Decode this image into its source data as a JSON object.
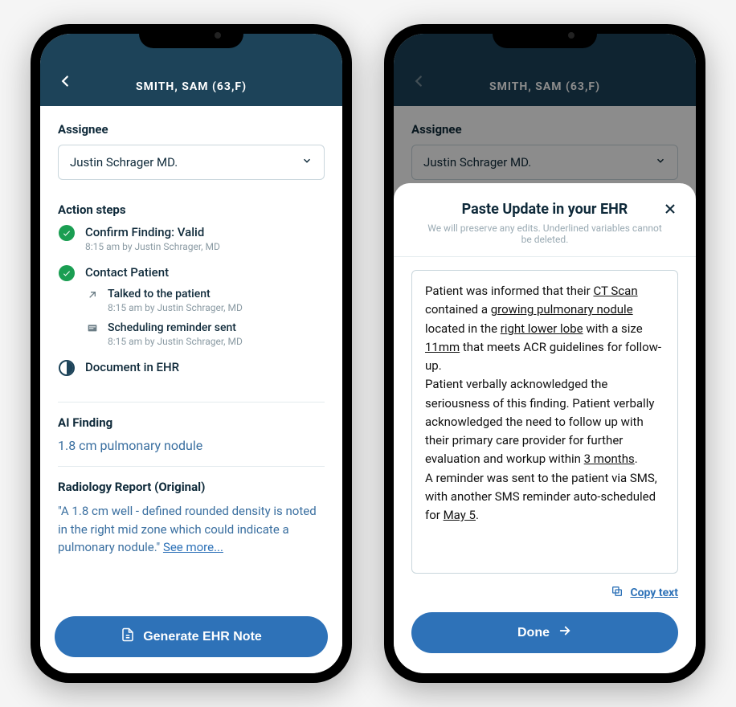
{
  "header": {
    "patient_title": "SMITH, SAM (63,F)"
  },
  "assignee": {
    "label": "Assignee",
    "value": "Justin Schrager MD."
  },
  "action_steps": {
    "label": "Action steps",
    "steps": [
      {
        "title": "Confirm Finding: Valid",
        "meta": "8:15 am by Justin Schrager, MD",
        "status": "done"
      },
      {
        "title": "Contact Patient",
        "status": "done",
        "substeps": [
          {
            "title": "Talked to the patient",
            "meta": "8:15 am by Justin Schrager, MD",
            "icon": "arrow"
          },
          {
            "title": "Scheduling reminder sent",
            "meta": "8:15 am by Justin Schrager, MD",
            "icon": "note"
          }
        ]
      },
      {
        "title": "Document in EHR",
        "status": "pending"
      }
    ]
  },
  "ai_finding": {
    "label": "AI Finding",
    "value": "1.8 cm pulmonary nodule"
  },
  "report": {
    "label": "Radiology Report (Original)",
    "text": "\"A 1.8 cm well - defined rounded density is noted in the right mid zone which could indicate a pulmonary nodule.\" ",
    "see_more": "See more..."
  },
  "buttons": {
    "generate": "Generate EHR Note",
    "done": "Done",
    "copy": "Copy text"
  },
  "sheet": {
    "title": "Paste Update in your EHR",
    "subtitle": "We will preserve any edits. Underlined variables cannot be deleted.",
    "note": {
      "p1_a": "Patient was informed that their ",
      "v1": "CT Scan",
      "p1_b": " contained a ",
      "v2": "growing pulmonary nodule",
      "p1_c": " located in the ",
      "v3": "right lower lobe",
      "p1_d": " with a size ",
      "v4": "11mm",
      "p1_e": " that meets ACR guidelines for follow-up.",
      "p2_a": "Patient verbally acknowledged the seriousness of this finding. Patient verbally acknowledged the need to follow up with their primary care provider for further evaluation and workup within ",
      "v5": "3 months",
      "p2_b": ".",
      "p3_a": "A reminder was sent to the patient via SMS, with another SMS reminder auto-scheduled for ",
      "v6": "May 5",
      "p3_b": "."
    }
  }
}
